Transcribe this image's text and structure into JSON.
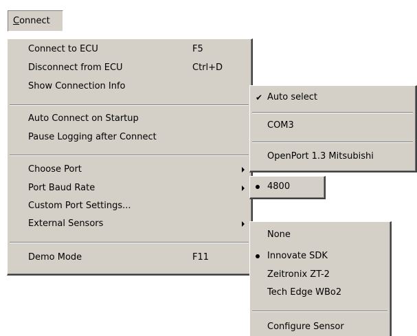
{
  "menubar": {
    "connect_label": "Connect"
  },
  "connect_menu": {
    "items": [
      {
        "label": "Connect to ECU",
        "shortcut": "F5"
      },
      {
        "label": "Disconnect from ECU",
        "shortcut": "Ctrl+D"
      },
      {
        "label": "Show Connection Info",
        "shortcut": ""
      },
      {
        "label": "Auto Connect on Startup",
        "shortcut": ""
      },
      {
        "label": "Pause Logging after Connect",
        "shortcut": ""
      },
      {
        "label": "Choose Port",
        "shortcut": ""
      },
      {
        "label": "Port Baud Rate",
        "shortcut": ""
      },
      {
        "label": "Custom Port Settings...",
        "shortcut": ""
      },
      {
        "label": "External Sensors",
        "shortcut": ""
      },
      {
        "label": "Demo Mode",
        "shortcut": "F11"
      }
    ]
  },
  "port_submenu": {
    "items": [
      {
        "label": "Auto select",
        "checked": true
      },
      {
        "label": "COM3",
        "checked": false
      },
      {
        "label": "OpenPort 1.3 Mitsubishi",
        "checked": false
      }
    ]
  },
  "baud_submenu": {
    "items": [
      {
        "label": "4800",
        "selected": true
      }
    ]
  },
  "sensors_submenu": {
    "items": [
      {
        "label": "None",
        "selected": false
      },
      {
        "label": "Innovate SDK",
        "selected": true
      },
      {
        "label": "Zeitronix ZT-2",
        "selected": false
      },
      {
        "label": "Tech Edge WBo2",
        "selected": false
      },
      {
        "label": "Configure Sensor",
        "selected": false
      }
    ]
  },
  "colors": {
    "menu_face": "#d4d0c8",
    "highlight_edge": "#ffffff",
    "shadow_edge": "#808080",
    "dark_edge": "#404040",
    "text": "#000000"
  }
}
